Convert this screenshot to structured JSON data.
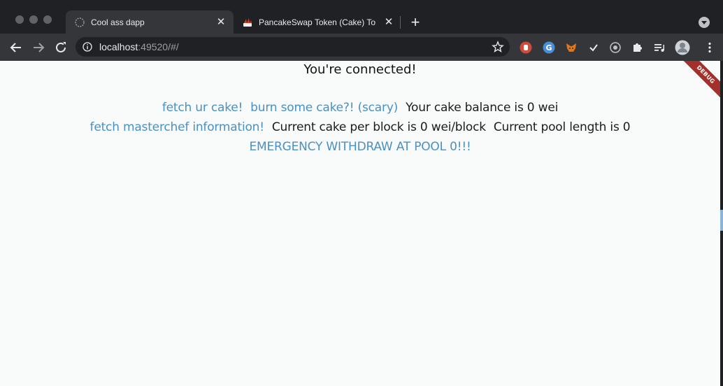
{
  "browser": {
    "tabs": [
      {
        "title": "Cool ass dapp",
        "icon": "globe-icon"
      },
      {
        "title": "PancakeSwap Token (Cake) To",
        "icon": "pancakeswap-favicon-icon"
      }
    ],
    "url": {
      "host": "localhost",
      "rest": ":49520/#/"
    }
  },
  "page": {
    "heading": "You're connected!",
    "actions": {
      "fetch_cake": "fetch ur cake!",
      "burn_cake": "burn some cake?! (scary)",
      "fetch_masterchef": "fetch masterchef information!",
      "emergency_withdraw": "EMERGENCY WITHDRAW AT POOL 0!!!"
    },
    "status": {
      "cake_balance": "Your cake balance is 0 wei",
      "cake_per_block": "Current cake per block is 0 wei/block",
      "pool_length": "Current pool length is 0"
    },
    "debug_banner": "DEBUG"
  },
  "colors": {
    "link": "#4a90c2",
    "page_bg": "#f9fbfb",
    "chrome_dark": "#202124",
    "chrome_toolbar": "#35363a",
    "debug_banner": "#a3302a"
  }
}
